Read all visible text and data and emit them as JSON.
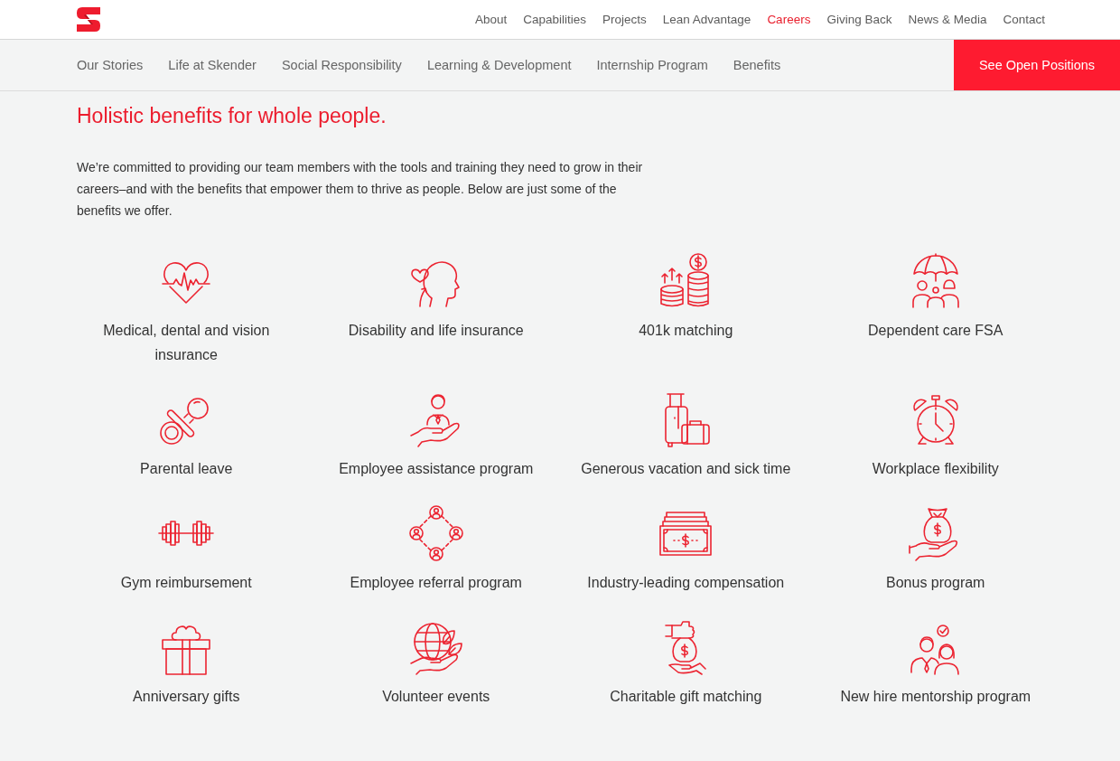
{
  "header": {
    "nav": [
      {
        "label": "About",
        "selected": false
      },
      {
        "label": "Capabilities",
        "selected": false
      },
      {
        "label": "Projects",
        "selected": false
      },
      {
        "label": "Lean Advantage",
        "selected": false
      },
      {
        "label": "Careers",
        "selected": true
      },
      {
        "label": "Giving Back",
        "selected": false
      },
      {
        "label": "News & Media",
        "selected": false
      },
      {
        "label": "Contact",
        "selected": false
      }
    ]
  },
  "subnav": {
    "items": [
      "Our Stories",
      "Life at Skender",
      "Social Responsibility",
      "Learning & Development",
      "Internship Program",
      "Benefits"
    ],
    "button": "See Open Positions"
  },
  "heading": "Holistic benefits for whole people.",
  "intro": "We’re committed to providing our team members with the tools and training they need to grow in their careers–and with the benefits that empower them to thrive as people. Below are just some of the benefits we offer.",
  "benefits": [
    "Medical, dental and vision insurance",
    "Disability and life insurance",
    "401k matching",
    "Dependent care FSA",
    "Parental leave",
    "Employee assistance program",
    "Generous vacation and sick time",
    "Workplace flexibility",
    "Gym reimbursement",
    "Employee referral program",
    "Industry-leading compensation",
    "Bonus program",
    "Anniversary gifts",
    "Volunteer events",
    "Charitable gift matching",
    "New hire mentorship program"
  ]
}
